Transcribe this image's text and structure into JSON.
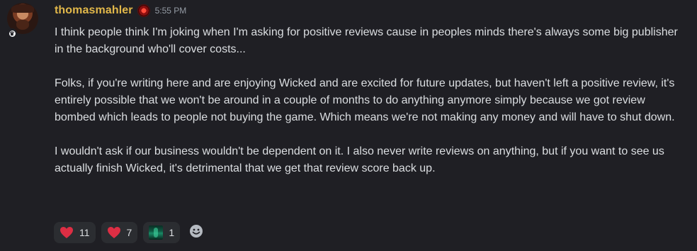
{
  "message": {
    "username": "thomasmahler",
    "timestamp": "5:55 PM",
    "role_icon": "red-orb-icon",
    "avatar_badge": "owner-badge",
    "paragraphs": [
      "I think people think I'm joking when I'm asking for positive reviews cause in peoples minds there's always some big publisher in the background who'll cover costs...",
      "Folks, if you're writing here and are enjoying Wicked and are excited for future updates, but haven't left a positive review, it's entirely possible that we won't be around in a couple of months to do anything anymore simply because we got review bombed which leads to people not buying the game. Which means we're not making any money and will have to shut down.",
      "I wouldn't ask if our business wouldn't be dependent on it. I also never write reviews on anything, but if you want to see us actually finish Wicked, it's detrimental that we get that review score back up."
    ]
  },
  "reactions": [
    {
      "emoji": "heart-icon",
      "count": "11"
    },
    {
      "emoji": "heart-icon",
      "count": "7"
    },
    {
      "emoji": "green-portal-icon",
      "count": "1"
    }
  ],
  "colors": {
    "background": "#1f1f24",
    "username": "#e2b84a",
    "text": "#dbdee1",
    "timestamp": "#949ba4",
    "reaction_bg": "#2b2d31",
    "heart": "#dd2e44"
  }
}
